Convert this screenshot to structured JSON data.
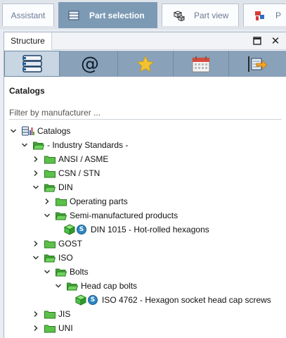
{
  "tabs": {
    "assistant": "Assistant",
    "part_selection": "Part selection",
    "part_view": "Part view",
    "more": "P"
  },
  "panel": {
    "tab_label": "Structure",
    "maximize_icon": "maximize-icon",
    "close_icon": "close-icon"
  },
  "toolbar": {
    "buttons": [
      {
        "name": "catalog-books-icon",
        "selected": true
      },
      {
        "name": "at-sign-icon",
        "selected": false
      },
      {
        "name": "favorites-star-icon",
        "selected": false
      },
      {
        "name": "calendar-icon",
        "selected": false
      },
      {
        "name": "export-icon",
        "selected": false
      }
    ]
  },
  "catalogs_title": "Catalogs",
  "filter": {
    "placeholder": "Filter by manufacturer ..."
  },
  "tree": [
    {
      "label": "Catalogs",
      "state": "expanded",
      "kind": "root"
    },
    {
      "label": "- Industry Standards -",
      "state": "expanded",
      "kind": "folder-open"
    },
    {
      "label": "ANSI / ASME",
      "state": "collapsed",
      "kind": "folder"
    },
    {
      "label": "CSN / STN",
      "state": "collapsed",
      "kind": "folder"
    },
    {
      "label": "DIN",
      "state": "expanded",
      "kind": "folder-open"
    },
    {
      "label": "Operating parts",
      "state": "collapsed",
      "kind": "folder"
    },
    {
      "label": "Semi-manufactured products",
      "state": "expanded",
      "kind": "folder-open"
    },
    {
      "label": "DIN 1015 - Hot-rolled hexagons",
      "state": "leaf",
      "kind": "part"
    },
    {
      "label": "GOST",
      "state": "collapsed",
      "kind": "folder"
    },
    {
      "label": "ISO",
      "state": "expanded",
      "kind": "folder-open"
    },
    {
      "label": "Bolts",
      "state": "expanded",
      "kind": "folder-open"
    },
    {
      "label": "Head cap bolts",
      "state": "expanded",
      "kind": "folder-open"
    },
    {
      "label": "ISO 4762 - Hexagon socket head cap screws",
      "state": "leaf",
      "kind": "part"
    },
    {
      "label": "JIS",
      "state": "collapsed",
      "kind": "folder"
    },
    {
      "label": "UNI",
      "state": "collapsed",
      "kind": "folder"
    }
  ],
  "badge_letter": "S",
  "colors": {
    "accent": "#7d9ab5",
    "toolbar": "#8aa2b9",
    "folder": "#5cc14a",
    "part_cube": "#4cc24a",
    "badge": "#2e86c1"
  }
}
